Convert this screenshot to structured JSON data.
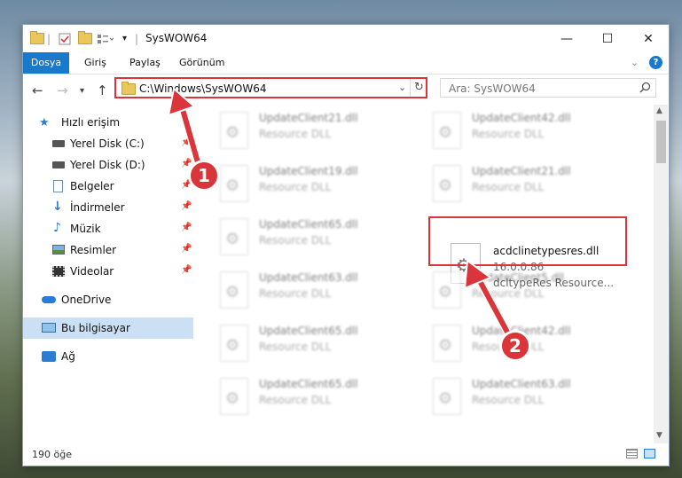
{
  "window": {
    "title": "SysWOW64",
    "controls": {
      "minimize": "—",
      "maximize": "☐",
      "close": "✕"
    }
  },
  "ribbon": {
    "tabs": [
      "Dosya",
      "Giriş",
      "Paylaş",
      "Görünüm"
    ],
    "help": "?"
  },
  "address_bar": {
    "path": "C:\\Windows\\SysWOW64",
    "search_placeholder": "Ara: SysWOW64"
  },
  "sidebar": {
    "items": [
      {
        "label": "Hızlı erişim",
        "icon": "star-icon"
      },
      {
        "label": "Yerel Disk (C:)",
        "icon": "drive-icon"
      },
      {
        "label": "Yerel Disk (D:)",
        "icon": "drive-icon"
      },
      {
        "label": "Belgeler",
        "icon": "documents-icon"
      },
      {
        "label": "İndirmeler",
        "icon": "download-icon"
      },
      {
        "label": "Müzik",
        "icon": "music-icon"
      },
      {
        "label": "Resimler",
        "icon": "pictures-icon"
      },
      {
        "label": "Videolar",
        "icon": "video-icon"
      },
      {
        "label": "OneDrive",
        "icon": "cloud-icon"
      },
      {
        "label": "Bu bilgisayar",
        "icon": "computer-icon",
        "selected": true
      },
      {
        "label": "Ağ",
        "icon": "network-icon"
      }
    ]
  },
  "files": [
    {
      "name": "UpdateClient21.dll",
      "type": "Resource DLL"
    },
    {
      "name": "UpdateClient42.dll",
      "type": "Resource DLL"
    },
    {
      "name": "UpdateClient19.dll",
      "type": "Resource DLL"
    },
    {
      "name": "UpdateClient21.dll",
      "type": "Resource DLL"
    },
    {
      "name": "UpdateClient65.dll",
      "type": "Resource DLL"
    },
    {
      "name": "acdclinetypesres.dll",
      "version": "16.0.0.86",
      "type": "dcltypeRes Resource..."
    },
    {
      "name": "UpdateClient63.dll",
      "type": "Resource DLL"
    },
    {
      "name": "UpdateClient5.dll",
      "type": "Resource DLL"
    },
    {
      "name": "UpdateClient65.dll",
      "type": "Resource DLL"
    },
    {
      "name": "UpdateClient42.dll",
      "type": "Resource DLL"
    },
    {
      "name": "UpdateClient65.dll",
      "type": "Resource DLL"
    },
    {
      "name": "UpdateClient63.dll",
      "type": "Resource DLL"
    }
  ],
  "callouts": [
    "1",
    "2"
  ],
  "status": {
    "count": "190 öğe"
  },
  "colors": {
    "accent": "#1979ca",
    "highlight": "#d9353a",
    "selected": "#cce0f5"
  }
}
